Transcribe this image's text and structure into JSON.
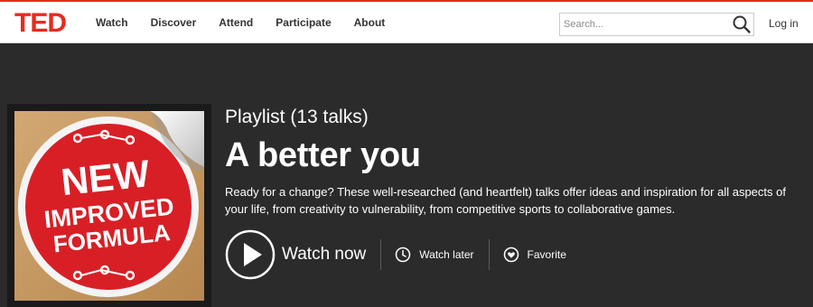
{
  "header": {
    "logo": "TED",
    "nav": [
      "Watch",
      "Discover",
      "Attend",
      "Participate",
      "About"
    ],
    "search_placeholder": "Search...",
    "login": "Log in"
  },
  "playlist": {
    "subtitle": "Playlist (13 talks)",
    "title": "A better you",
    "description": "Ready for a change? These well-researched (and heartfelt) talks offer ideas and inspiration for all aspects of your life, from creativity to vulnerability, from competitive sports to collaborative games.",
    "thumbnail_text": [
      "NEW",
      "IMPROVED",
      "FORMULA"
    ]
  },
  "actions": {
    "watch_now": "Watch now",
    "watch_later": "Watch later",
    "favorite": "Favorite"
  },
  "colors": {
    "brand_red": "#e62b1e",
    "hero_bg": "#2b2b2b",
    "sticker_red": "#d81f26",
    "board_tan": "#c79a62"
  },
  "icons": {
    "search": "search-icon",
    "play": "play-icon",
    "watch_later": "clock-icon",
    "favorite": "heart-icon"
  }
}
